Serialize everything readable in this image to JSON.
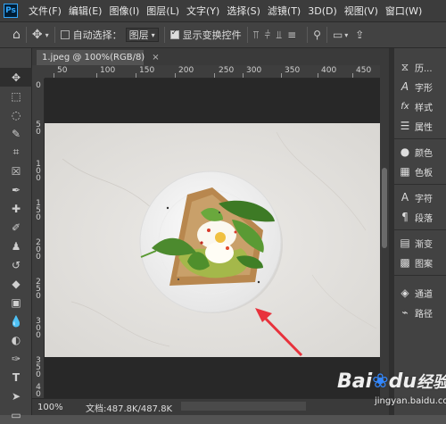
{
  "app": {
    "logo": "Ps"
  },
  "menu": [
    "文件(F)",
    "编辑(E)",
    "图像(I)",
    "图层(L)",
    "文字(Y)",
    "选择(S)",
    "滤镜(T)",
    "3D(D)",
    "视图(V)",
    "窗口(W)"
  ],
  "options": {
    "auto_select_label": "自动选择：",
    "auto_select_checked": false,
    "layer_dropdown_value": "图层",
    "show_transform_label": "显示变换控件",
    "show_transform_checked": true
  },
  "document": {
    "tab_label": "1.jpeg @ 100%(RGB/8)",
    "close_glyph": "×"
  },
  "ruler": {
    "h_ticks": [
      "50",
      "100",
      "150",
      "200",
      "250",
      "300",
      "350",
      "400",
      "450"
    ],
    "v_ticks": [
      "0",
      "5",
      "0",
      "1",
      "0",
      "0",
      "1",
      "5",
      "0",
      "2",
      "0",
      "0",
      "2",
      "5",
      "0",
      "3",
      "0",
      "0",
      "3",
      "5",
      "0",
      "4",
      "0",
      "0"
    ]
  },
  "status": {
    "zoom": "100%",
    "doc_info": "文档:487.8K/487.8K"
  },
  "panels": {
    "group1": [
      {
        "icon": "history-icon",
        "glyph": "⧖",
        "label": "历..."
      },
      {
        "icon": "character-icon",
        "glyph": "A",
        "label": "字形"
      },
      {
        "icon": "styles-icon",
        "glyph": "fx",
        "label": "样式"
      },
      {
        "icon": "properties-icon",
        "glyph": "☰",
        "label": "属性"
      }
    ],
    "group2": [
      {
        "icon": "color-icon",
        "glyph": "●",
        "label": "颜色"
      },
      {
        "icon": "swatches-icon",
        "glyph": "▦",
        "label": "色板"
      }
    ],
    "group3": [
      {
        "icon": "character-text-icon",
        "glyph": "A",
        "label": "字符"
      },
      {
        "icon": "paragraph-icon",
        "glyph": "¶",
        "label": "段落"
      }
    ],
    "group4": [
      {
        "icon": "gradient-icon",
        "glyph": "▤",
        "label": "渐变"
      },
      {
        "icon": "pattern-icon",
        "glyph": "▩",
        "label": "图案"
      }
    ],
    "group5": [
      {
        "icon": "channels-icon",
        "glyph": "◈",
        "label": "通道"
      },
      {
        "icon": "paths-icon",
        "glyph": "⌁",
        "label": "路径"
      }
    ]
  },
  "watermark": {
    "brand": "Bai",
    "brand2": "du",
    "brand_zh": "经验",
    "url": "jingyan.baidu.com"
  },
  "colors": {
    "arrow": "#e8323c",
    "plate": "#f3f3f3",
    "marble": "#e4e2df"
  }
}
